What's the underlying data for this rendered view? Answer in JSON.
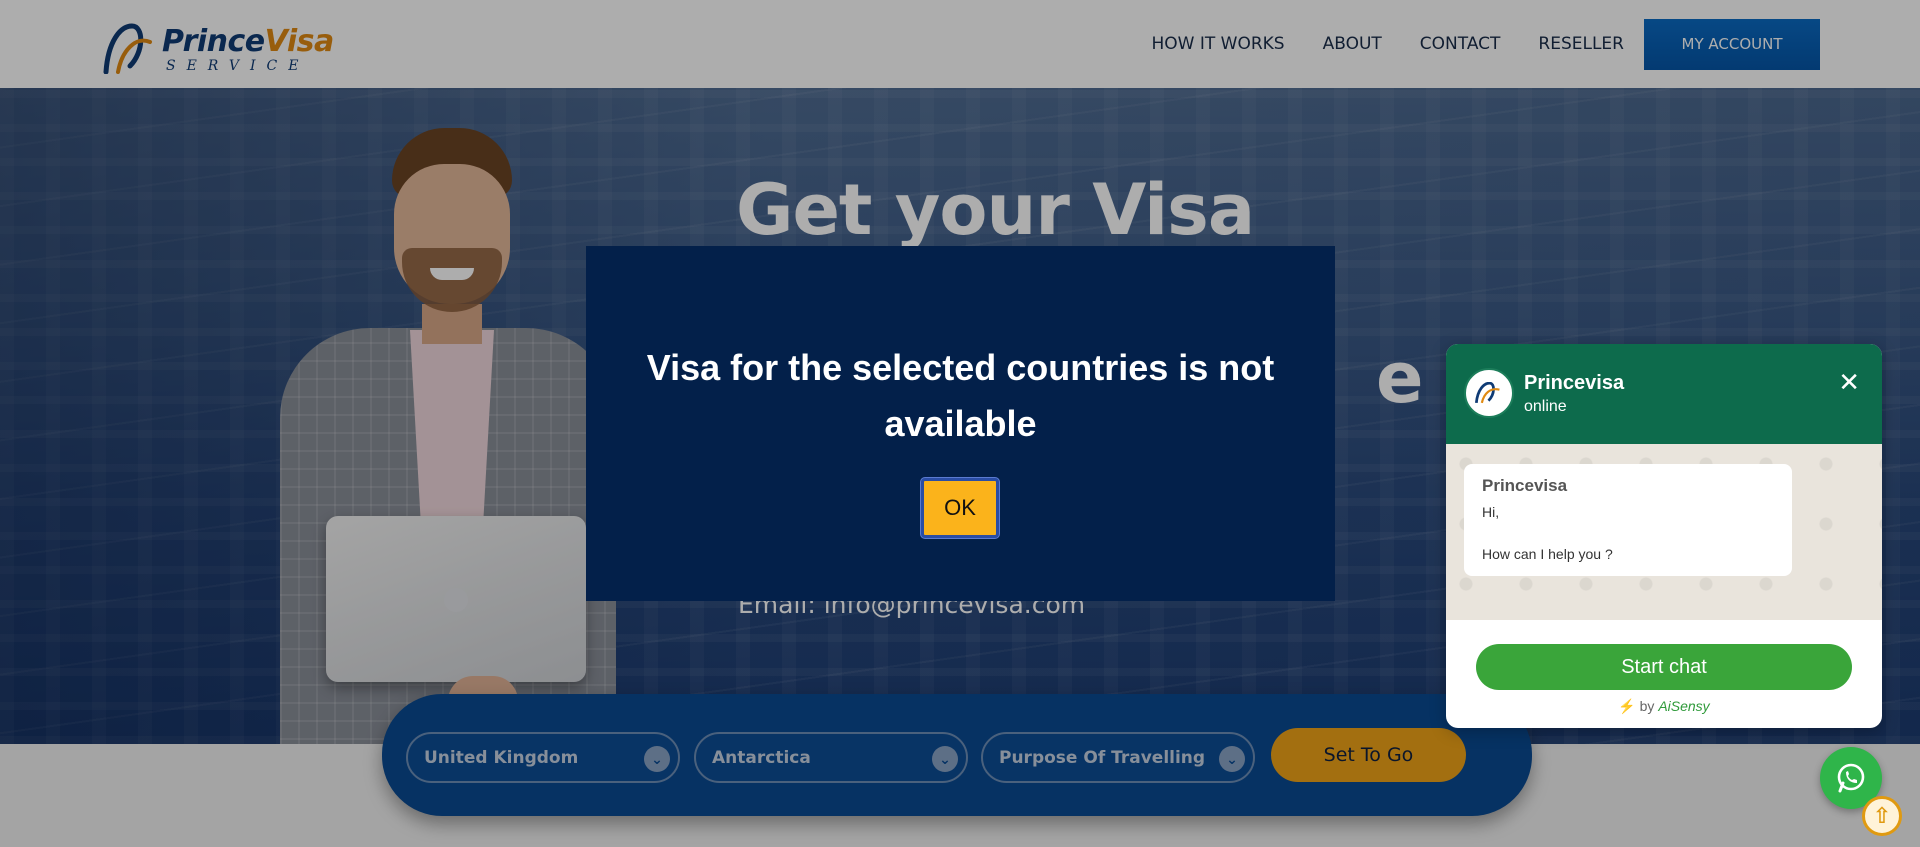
{
  "brand": {
    "name_part1": "Prince",
    "name_part2": "Visa",
    "tagline": "SERVICE"
  },
  "nav": {
    "items": [
      "HOW IT WORKS",
      "ABOUT",
      "CONTACT",
      "RESELLER"
    ],
    "account_label": "MY ACCOUNT"
  },
  "hero": {
    "title_line1": "Get your Visa with",
    "title_line2_partial": "e",
    "email": "Email: info@princevisa.com"
  },
  "search": {
    "from_country": "United Kingdom",
    "to_country": "Antarctica",
    "purpose": "Purpose Of Travelling",
    "submit_label": "Set To Go"
  },
  "modal": {
    "message": "Visa for the selected countries is not available",
    "ok_label": "OK"
  },
  "chat": {
    "name": "Princevisa",
    "status": "online",
    "close_glyph": "✕",
    "message_sender": "Princevisa",
    "message_line1": "Hi,",
    "message_line2": "How can I help you ?",
    "start_label": "Start chat",
    "powered_prefix": "by",
    "powered_brand": "AiSensy"
  },
  "colors": {
    "modal_bg": "#03204a",
    "ok_button": "#fbb31b",
    "chat_header": "#0d6b4c",
    "start_chat": "#3aa53a",
    "submit_button": "#f0a418",
    "account_button": "#0556a8"
  },
  "icons": [
    "logo-mark-icon",
    "chevron-down-icon",
    "close-icon",
    "bolt-icon",
    "whatsapp-icon",
    "arrow-up-icon"
  ]
}
